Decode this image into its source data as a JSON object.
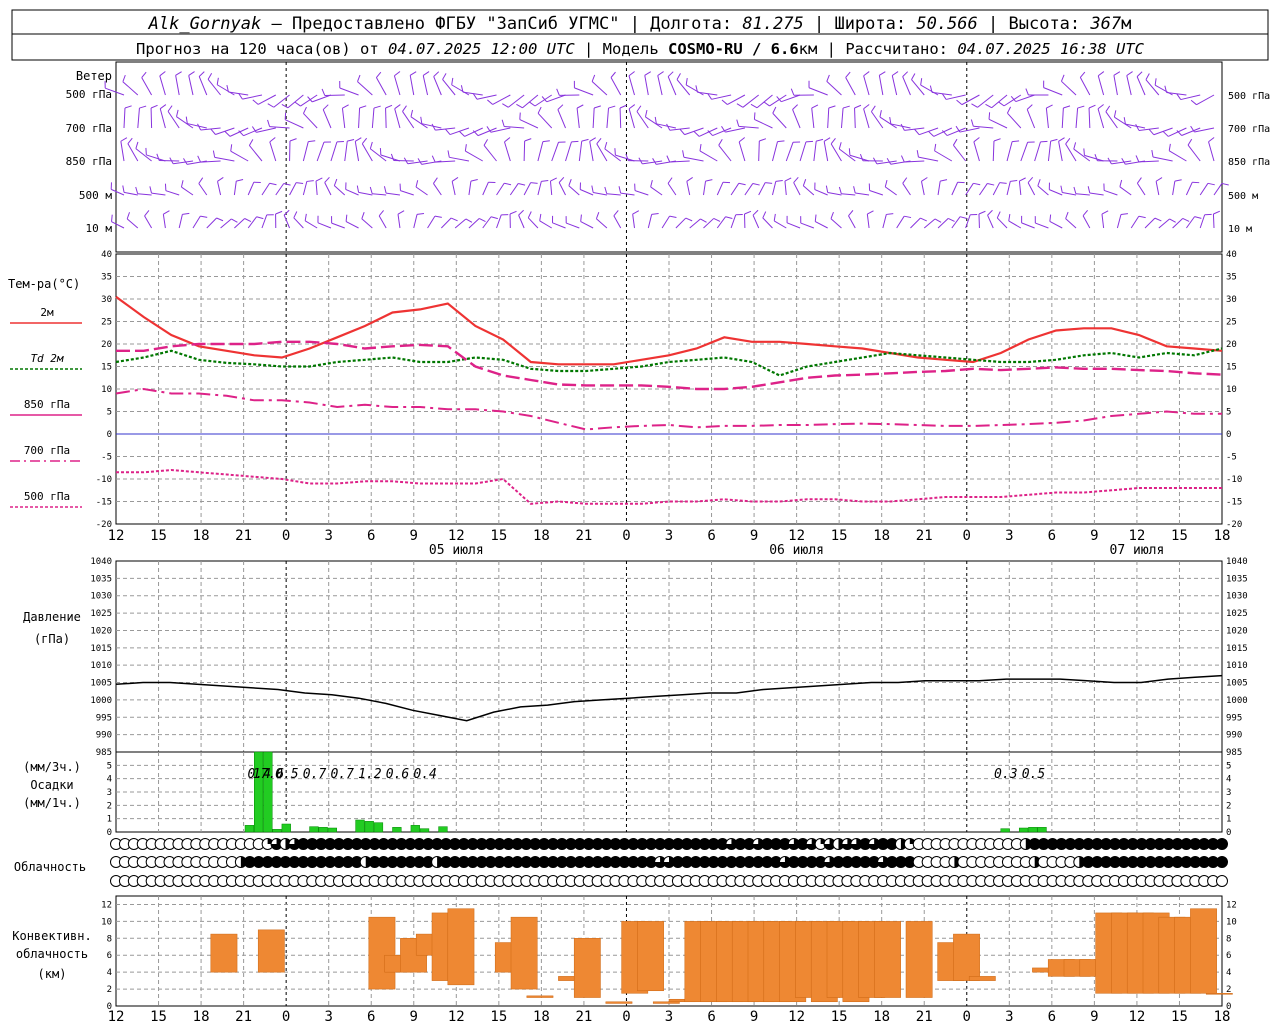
{
  "header": {
    "station": "Alk_Gornyak",
    "dash": " – ",
    "provider": "Предоставлено ФГБУ \"ЗапСиб УГМС\"",
    "lon_label": "Долгота:",
    "lon_value": "81.275",
    "lat_label": "Широта:",
    "lat_value": "50.566",
    "alt_label": "Высота:",
    "alt_value": "367",
    "alt_unit": "м",
    "forecast_prefix": "Прогноз на 120 часа(ов) от",
    "forecast_time": "04.07.2025 12:00 UTC",
    "model_label": "Модель",
    "model_value": "COSMO-RU / 6.6",
    "model_unit": "км",
    "calc_label": "Рассчитано:",
    "calc_time": "04.07.2025 16:38 UTC"
  },
  "labels": {
    "wind": "Ветер",
    "wind_levels": [
      "500 гПа",
      "700 гПа",
      "850 гПа",
      "500 м",
      "10 м"
    ],
    "temp_title": "Тем-ра(°C)",
    "temp_legend": [
      "2м",
      "Td  2м",
      "850 гПа",
      "700 гПа",
      "500 гПа"
    ],
    "pressure_title": "Давление",
    "pressure_unit": "(гПа)",
    "precip_unit_top": "(мм/3ч.)",
    "precip_title": "Осадки",
    "precip_unit_bottom": "(мм/1ч.)",
    "cloud_title": "Облачность",
    "conv_title": [
      "Конвективн.",
      "облачность",
      "(км)"
    ]
  },
  "colors": {
    "temp2m": "#ee3333",
    "td2m": "#007700",
    "t850": "#dd2288",
    "t700": "#dd2288",
    "t500": "#dd2288",
    "zero_line": "#3333cc",
    "wind": "#8833dd",
    "precip": "#22cc22",
    "conv": "#ee8833",
    "grid": "#999999"
  },
  "chart_data": {
    "type": "line",
    "time_axis": {
      "tick_labels": [
        "12",
        "15",
        "18",
        "21",
        "0",
        "3",
        "6",
        "9",
        "12",
        "15",
        "18",
        "21",
        "0",
        "3",
        "6",
        "9",
        "12",
        "15",
        "18",
        "21",
        "0",
        "3",
        "6",
        "9",
        "12",
        "15",
        "18"
      ],
      "day_labels": [
        {
          "label": "05 июля",
          "index": 8
        },
        {
          "label": "06 июля",
          "index": 16
        },
        {
          "label": "07 июля",
          "index": 24
        }
      ],
      "day_boundaries": [
        4,
        12,
        20
      ]
    },
    "temperature": {
      "ylim": [
        -20,
        40
      ],
      "ticks": [
        40,
        35,
        30,
        25,
        20,
        15,
        10,
        5,
        0,
        -5,
        -10,
        -15,
        -20
      ],
      "series": [
        {
          "name": "2м",
          "style": "solid",
          "values": [
            30.5,
            26,
            22,
            19.5,
            18.5,
            17.5,
            17,
            19,
            21.5,
            24,
            27,
            27.7,
            29,
            24,
            21,
            16,
            15.5,
            15.5,
            15.5,
            16.5,
            17.5,
            19,
            21.5,
            20.5,
            20.5,
            20,
            19.5,
            19,
            18,
            17,
            16.5,
            16,
            18,
            21,
            23,
            23.5,
            23.5,
            22,
            19.5,
            19,
            18.5
          ]
        },
        {
          "name": "Td  2м",
          "style": "dotted",
          "values": [
            16,
            17,
            18.5,
            16.5,
            15.8,
            15.5,
            15,
            15,
            16,
            16.5,
            17,
            16,
            16,
            17,
            16.5,
            14.5,
            14,
            14,
            14.5,
            15,
            16,
            16.5,
            17,
            16,
            13,
            15,
            16,
            17,
            18,
            17.5,
            17,
            16.5,
            16,
            16,
            16.5,
            17.5,
            18,
            17,
            18,
            17.5,
            19
          ]
        },
        {
          "name": "850 гПа",
          "style": "dashed",
          "values": [
            18.5,
            18.5,
            19.5,
            20,
            20,
            20,
            20.5,
            20.5,
            20,
            19,
            19.5,
            19.8,
            19.5,
            15,
            13,
            12,
            11,
            10.8,
            10.8,
            10.8,
            10.5,
            10,
            10,
            10.5,
            11.5,
            12.5,
            13,
            13.2,
            13.5,
            13.8,
            14,
            14.5,
            14.2,
            14.5,
            14.8,
            14.5,
            14.5,
            14.2,
            14,
            13.5,
            13.2
          ]
        },
        {
          "name": "700 гПа",
          "style": "dashdot",
          "values": [
            9,
            10,
            9,
            9,
            8.5,
            7.5,
            7.5,
            7,
            6,
            6.5,
            6,
            6,
            5.5,
            5.5,
            5,
            4,
            2.5,
            1,
            1.5,
            1.8,
            2,
            1.5,
            1.8,
            1.8,
            2,
            2,
            2.2,
            2.3,
            2.2,
            2,
            1.8,
            1.8,
            2,
            2.2,
            2.5,
            3,
            4,
            4.5,
            5,
            4.5,
            4.5
          ]
        },
        {
          "name": "500 гПа",
          "style": "densedash",
          "values": [
            -8.5,
            -8.5,
            -8,
            -8.5,
            -9,
            -9.5,
            -10,
            -11,
            -11,
            -10.5,
            -10.5,
            -11,
            -11,
            -11,
            -10,
            -15.5,
            -15,
            -15.5,
            -15.5,
            -15.5,
            -15,
            -15,
            -14.5,
            -15,
            -15,
            -14.5,
            -14.5,
            -15,
            -15,
            -14.5,
            -14,
            -14,
            -14,
            -13.5,
            -13,
            -13,
            -12.5,
            -12,
            -12,
            -12,
            -12
          ]
        }
      ]
    },
    "pressure": {
      "ylim": [
        985,
        1040
      ],
      "ticks": [
        1040,
        1035,
        1030,
        1025,
        1020,
        1015,
        1010,
        1005,
        1000,
        995,
        990,
        985
      ],
      "values": [
        1004.5,
        1005,
        1005,
        1004.5,
        1004,
        1003.5,
        1003,
        1002,
        1001.5,
        1000.5,
        999,
        997,
        995.5,
        994,
        996.5,
        998,
        998.5,
        999.5,
        1000,
        1000.5,
        1001,
        1001.5,
        1002,
        1002,
        1003,
        1003.5,
        1004,
        1004.5,
        1005,
        1005,
        1005.5,
        1005.5,
        1005.5,
        1006,
        1006,
        1006,
        1005.5,
        1005,
        1005,
        1006,
        1006.5,
        1007
      ]
    },
    "precip": {
      "left_ticks": [
        "5",
        "4",
        "3",
        "2",
        "1",
        "0"
      ],
      "right_ticks": [
        "5",
        "4",
        "3",
        "2",
        "1",
        "0"
      ],
      "labels": [
        {
          "t": 15,
          "text": "0.4"
        },
        {
          "t": 16,
          "text": "17.6"
        },
        {
          "t": 18,
          "text": "0.5"
        },
        {
          "t": 21,
          "text": "0.7"
        },
        {
          "t": 24,
          "text": "0.7"
        },
        {
          "t": 27,
          "text": "1.2"
        },
        {
          "t": 30,
          "text": "0.6"
        },
        {
          "t": 33,
          "text": "0.4"
        },
        {
          "t": 96,
          "text": "0.3"
        },
        {
          "t": 99,
          "text": "0.5"
        }
      ],
      "bars": [
        {
          "t": 14,
          "v": 0.5
        },
        {
          "t": 15,
          "v": 6
        },
        {
          "t": 16,
          "v": 6
        },
        {
          "t": 17,
          "v": 0.2
        },
        {
          "t": 18,
          "v": 0.6
        },
        {
          "t": 21,
          "v": 0.4
        },
        {
          "t": 22,
          "v": 0.35
        },
        {
          "t": 23,
          "v": 0.3
        },
        {
          "t": 26,
          "v": 0.9
        },
        {
          "t": 27,
          "v": 0.8
        },
        {
          "t": 28,
          "v": 0.7
        },
        {
          "t": 30,
          "v": 0.35
        },
        {
          "t": 32,
          "v": 0.5
        },
        {
          "t": 33,
          "v": 0.25
        },
        {
          "t": 35,
          "v": 0.4
        },
        {
          "t": 96,
          "v": 0.25
        },
        {
          "t": 98,
          "v": 0.3
        },
        {
          "t": 99,
          "v": 0.35
        },
        {
          "t": 100,
          "v": 0.35
        }
      ]
    },
    "cloud": {
      "rows": [
        [
          0,
          0,
          0,
          0,
          0,
          0,
          0,
          0,
          0,
          0,
          0,
          0,
          0,
          0,
          0,
          0,
          0,
          1,
          3,
          2,
          3,
          4,
          4,
          4,
          4,
          4,
          4,
          4,
          4,
          4,
          4,
          4,
          4,
          4,
          4,
          4,
          4,
          4,
          4,
          4,
          4,
          4,
          4,
          4,
          4,
          4,
          4,
          4,
          4,
          4,
          4,
          4,
          4,
          4,
          4,
          4,
          4,
          4,
          4,
          4,
          4,
          4,
          4,
          4,
          4,
          4,
          4,
          4,
          4,
          3,
          4,
          4,
          3,
          4,
          4,
          4,
          3,
          4,
          3,
          1,
          3,
          2,
          3,
          3,
          4,
          3,
          4,
          4,
          2,
          1,
          0,
          0,
          0,
          0,
          0,
          0,
          0,
          0,
          0,
          0,
          0,
          0,
          2,
          4,
          4,
          4,
          4,
          4,
          4,
          4,
          4,
          4,
          4,
          4,
          4,
          4,
          4,
          4,
          4,
          4,
          4,
          4,
          4,
          4,
          4
        ],
        [
          0,
          0,
          0,
          0,
          0,
          0,
          0,
          0,
          0,
          0,
          0,
          0,
          0,
          0,
          2,
          4,
          4,
          4,
          4,
          4,
          4,
          4,
          4,
          4,
          4,
          4,
          4,
          4,
          2,
          4,
          4,
          4,
          4,
          4,
          4,
          4,
          2,
          4,
          4,
          4,
          4,
          4,
          4,
          4,
          4,
          4,
          4,
          4,
          4,
          4,
          4,
          4,
          4,
          4,
          4,
          4,
          4,
          4,
          4,
          4,
          4,
          3,
          3,
          4,
          4,
          4,
          4,
          4,
          4,
          4,
          4,
          4,
          4,
          4,
          4,
          3,
          4,
          4,
          4,
          4,
          3,
          4,
          4,
          4,
          4,
          4,
          3,
          4,
          4,
          4,
          0,
          0,
          0,
          0,
          2,
          0,
          0,
          0,
          0,
          0,
          0,
          0,
          0,
          2,
          0,
          0,
          0,
          0,
          2,
          4,
          4,
          4,
          4,
          4,
          4,
          4,
          4,
          4,
          4,
          4,
          4,
          4,
          4,
          4,
          4
        ],
        [
          0,
          0,
          0,
          0,
          0,
          0,
          0,
          0,
          0,
          0,
          0,
          0,
          0,
          0,
          0,
          0,
          0,
          0,
          0,
          0,
          0,
          0,
          0,
          0,
          0,
          0,
          0,
          0,
          0,
          0,
          0,
          0,
          0,
          0,
          0,
          0,
          0,
          0,
          0,
          0,
          0,
          0,
          0,
          0,
          0,
          0,
          0,
          0,
          0,
          0,
          0,
          0,
          0,
          0,
          0,
          0,
          0,
          0,
          0,
          0,
          0,
          0,
          0,
          0,
          0,
          0,
          0,
          0,
          0,
          0,
          0,
          0,
          0,
          0,
          0,
          0,
          0,
          0,
          0,
          0,
          0,
          0,
          0,
          0,
          0,
          0,
          0,
          0,
          0,
          0,
          0,
          0,
          0,
          0,
          0,
          0,
          0,
          0,
          0,
          0,
          0,
          0,
          0,
          0,
          0,
          0,
          0,
          0,
          0,
          0,
          0,
          0,
          0,
          0,
          0,
          0,
          0,
          0,
          0,
          0,
          0,
          0,
          0,
          0,
          0
        ]
      ]
    },
    "convective": {
      "ticks": [
        12,
        10,
        8,
        6,
        4,
        2,
        0
      ],
      "ylim": [
        0,
        13
      ],
      "bars": [
        {
          "t": 18,
          "b": 4,
          "top": 8.5
        },
        {
          "t": 21,
          "b": 4,
          "top": 9
        },
        {
          "t": 28,
          "b": 2,
          "top": 10.5
        },
        {
          "t": 29,
          "b": 4,
          "top": 6
        },
        {
          "t": 30,
          "b": 4,
          "top": 8
        },
        {
          "t": 31,
          "b": 6,
          "top": 8.5
        },
        {
          "t": 32,
          "b": 3,
          "top": 11
        },
        {
          "t": 33,
          "b": 2.5,
          "top": 11.5
        },
        {
          "t": 36,
          "b": 4,
          "top": 7.5
        },
        {
          "t": 37,
          "b": 2,
          "top": 10.5
        },
        {
          "t": 38,
          "b": 1,
          "top": 1.2
        },
        {
          "t": 40,
          "b": 3,
          "top": 3.5
        },
        {
          "t": 41,
          "b": 1,
          "top": 8
        },
        {
          "t": 43,
          "b": 0.3,
          "top": 0.5
        },
        {
          "t": 44,
          "b": 1.5,
          "top": 10
        },
        {
          "t": 45,
          "b": 1.8,
          "top": 10
        },
        {
          "t": 46,
          "b": 0.3,
          "top": 0.5
        },
        {
          "t": 47,
          "b": 0.5,
          "top": 0.8
        },
        {
          "t": 48,
          "b": 0.5,
          "top": 10
        },
        {
          "t": 49,
          "b": 0.5,
          "top": 10
        },
        {
          "t": 50,
          "b": 0.5,
          "top": 10
        },
        {
          "t": 51,
          "b": 0.5,
          "top": 10
        },
        {
          "t": 52,
          "b": 0.5,
          "top": 10
        },
        {
          "t": 53,
          "b": 0.5,
          "top": 10
        },
        {
          "t": 54,
          "b": 0.5,
          "top": 10
        },
        {
          "t": 55,
          "b": 1,
          "top": 10
        },
        {
          "t": 56,
          "b": 0.5,
          "top": 10
        },
        {
          "t": 57,
          "b": 1,
          "top": 10
        },
        {
          "t": 58,
          "b": 0.5,
          "top": 10
        },
        {
          "t": 59,
          "b": 1,
          "top": 10
        },
        {
          "t": 60,
          "b": 1,
          "top": 10
        },
        {
          "t": 62,
          "b": 1,
          "top": 10
        },
        {
          "t": 64,
          "b": 3,
          "top": 7.5
        },
        {
          "t": 65,
          "b": 3,
          "top": 8.5
        },
        {
          "t": 66,
          "b": 3,
          "top": 3.5
        },
        {
          "t": 70,
          "b": 4,
          "top": 4.5
        },
        {
          "t": 71,
          "b": 3.5,
          "top": 5.5
        },
        {
          "t": 72,
          "b": 3.5,
          "top": 5.5
        },
        {
          "t": 73,
          "b": 3.5,
          "top": 5.5
        },
        {
          "t": 74,
          "b": 1.5,
          "top": 11
        },
        {
          "t": 75,
          "b": 1.5,
          "top": 11
        },
        {
          "t": 76,
          "b": 1.5,
          "top": 11
        },
        {
          "t": 77,
          "b": 1.5,
          "top": 11
        },
        {
          "t": 78,
          "b": 1.5,
          "top": 10.5
        },
        {
          "t": 79,
          "b": 1.5,
          "top": 10.5
        },
        {
          "t": 80,
          "b": 1.5,
          "top": 11.5
        },
        {
          "t": 81,
          "b": 1.5,
          "top": 1.5
        }
      ]
    }
  }
}
